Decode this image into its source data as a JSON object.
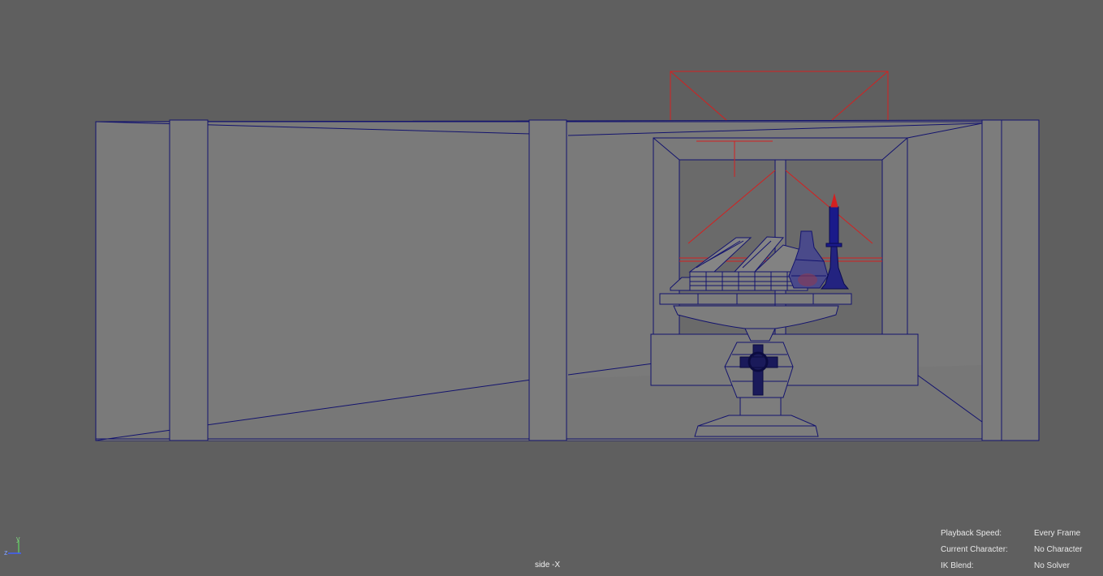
{
  "viewport": {
    "camera_label": "side -X",
    "axis_labels": {
      "y": "y",
      "z": "z"
    }
  },
  "hud": [
    {
      "key": "Playback Speed:",
      "value": "Every Frame"
    },
    {
      "key": "Current Character:",
      "value": "No Character"
    },
    {
      "key": "IK Blend:",
      "value": "No Solver"
    }
  ],
  "colors": {
    "background": "#5f5f5f",
    "wireframe": "#13136e",
    "camera_gizmo": "#d42020",
    "flame": "#d42020"
  }
}
